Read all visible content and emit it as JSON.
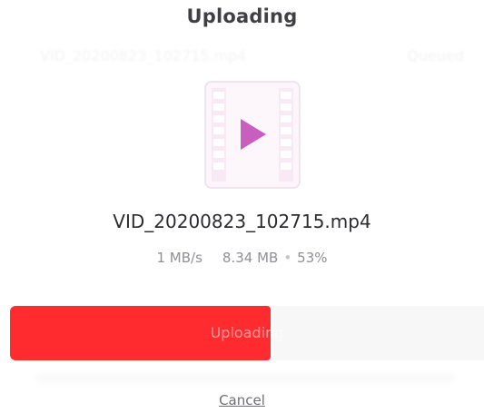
{
  "dialog": {
    "title": "Uploading",
    "ghost_file_name": "VID_20200823_102715.mp4",
    "ghost_status": "Queued"
  },
  "file": {
    "icon": "video-file-icon",
    "name": "VID_20200823_102715.mp4",
    "speed": "1 MB/s",
    "size": "8.34 MB",
    "separator": "•",
    "percent_label": "53%"
  },
  "progress": {
    "fraction": 0.55,
    "label": "Uploading",
    "fill_color": "#ff2b2f"
  },
  "actions": {
    "cancel_label": "Cancel"
  },
  "colors": {
    "icon_play": "#c85fc0",
    "icon_frame": "#f2e6f1",
    "icon_holes": "#f4e4f0"
  }
}
